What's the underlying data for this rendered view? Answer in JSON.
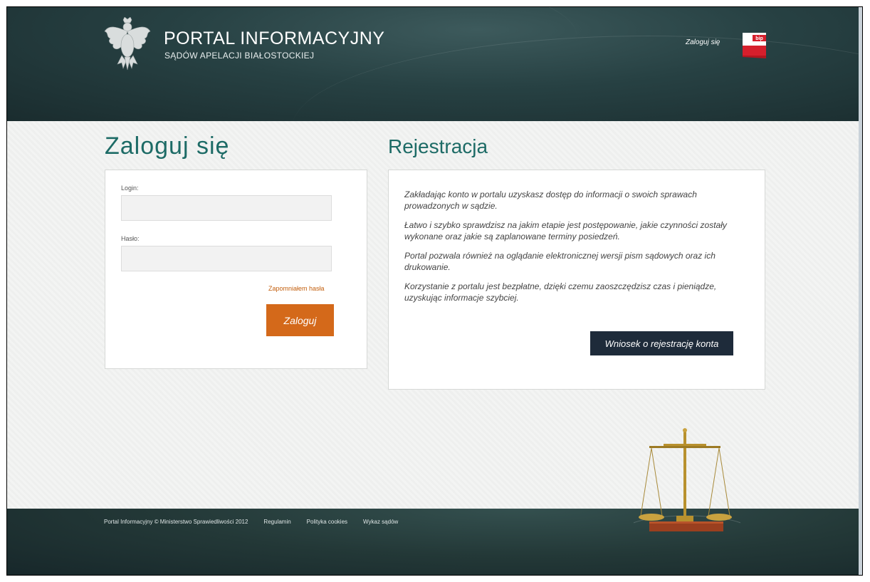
{
  "header": {
    "title": "PORTAL INFORMACYJNY",
    "subtitle": "SĄDÓW APELACJI BIAŁOSTOCKIEJ",
    "login_link": "Zaloguj się",
    "bip_label": "bip"
  },
  "login": {
    "heading": "Zaloguj się",
    "login_label": "Login:",
    "login_value": "",
    "password_label": "Hasło:",
    "password_value": "",
    "forgot_link": "Zapomniałem hasła",
    "submit_label": "Zaloguj"
  },
  "registration": {
    "heading": "Rejestracja",
    "paragraphs": [
      "Zakładając konto w portalu uzyskasz dostęp do informacji o swoich sprawach prowadzonych w sądzie.",
      "Łatwo i szybko sprawdzisz na jakim etapie jest postępowanie, jakie czynności zostały wykonane oraz jakie są zaplanowane terminy posiedzeń.",
      "Portal pozwala również na oglądanie elektronicznej wersji pism sądowych oraz ich drukowanie.",
      "Korzystanie z portalu jest bezpłatne, dzięki czemu zaoszczędzisz czas i pieniądze, uzyskując informacje szybciej."
    ],
    "button_label": "Wniosek o rejestrację konta"
  },
  "footer": {
    "copyright": "Portal Informacyjny © Ministerstwo Sprawiedliwości 2012",
    "links": [
      "Regulamin",
      "Polityka cookies",
      "Wykaz sądów"
    ]
  },
  "colors": {
    "accent_teal": "#1d6b66",
    "login_button": "#d4691a",
    "register_button": "#1e2b3a",
    "header_bg": "#274143"
  },
  "icons": [
    "polish-eagle-emblem",
    "bip-flag-icon",
    "scales-of-justice"
  ]
}
